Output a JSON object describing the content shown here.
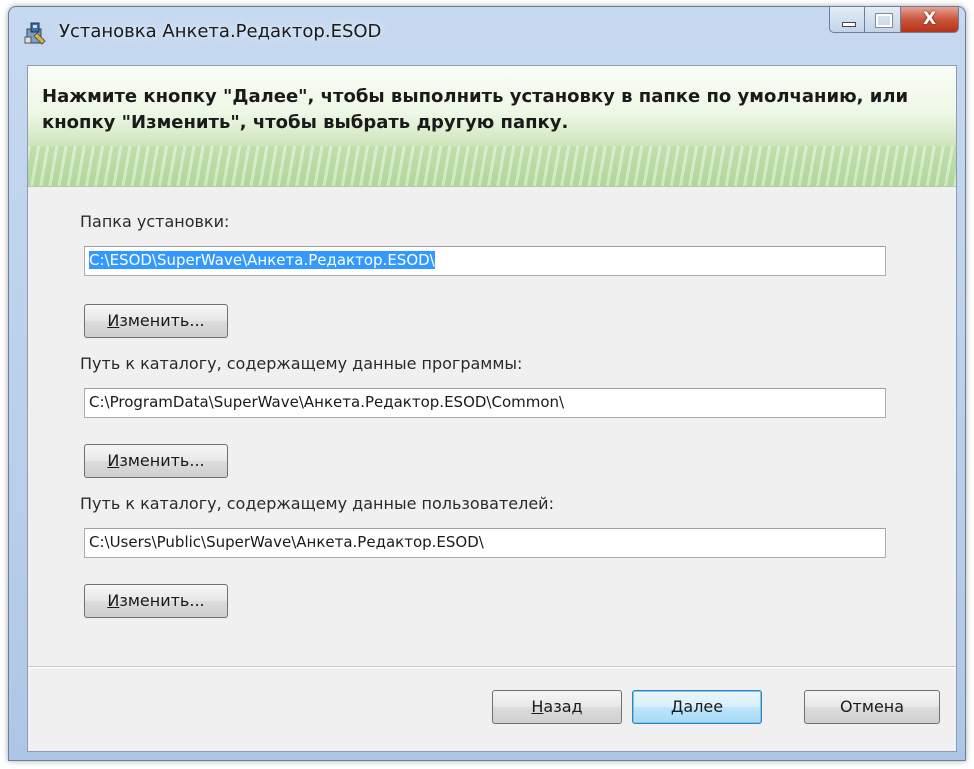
{
  "window": {
    "title": "Установка Анкета.Редактор.ESOD",
    "close_symbol": "X"
  },
  "banner": {
    "instruction": "Нажмите кнопку \"Далее\", чтобы выполнить установку в папке по умолчанию, или кнопку \"Изменить\", чтобы выбрать другую папку."
  },
  "install_folder": {
    "label": "Папка установки:",
    "value": "C:\\ESOD\\SuperWave\\Анкета.Редактор.ESOD\\",
    "change_first": "И",
    "change_rest": "зменить..."
  },
  "program_data": {
    "label": "Путь к каталогу, содержащему данные программы:",
    "value": "C:\\ProgramData\\SuperWave\\Анкета.Редактор.ESOD\\Common\\",
    "change_first": "И",
    "change_rest": "зменить..."
  },
  "user_data": {
    "label": "Путь к каталогу, содержащему данные пользователей:",
    "value": "C:\\Users\\Public\\SuperWave\\Анкета.Редактор.ESOD\\",
    "change_first": "И",
    "change_rest": "зменить..."
  },
  "footer": {
    "back_first": "Н",
    "back_rest": "азад",
    "next_first": "Д",
    "next_rest": "алее",
    "cancel": "Отмена"
  },
  "icons": {
    "app": "installer-icon",
    "minimize": "minimize-icon",
    "maximize": "maximize-icon",
    "close": "close-icon"
  }
}
